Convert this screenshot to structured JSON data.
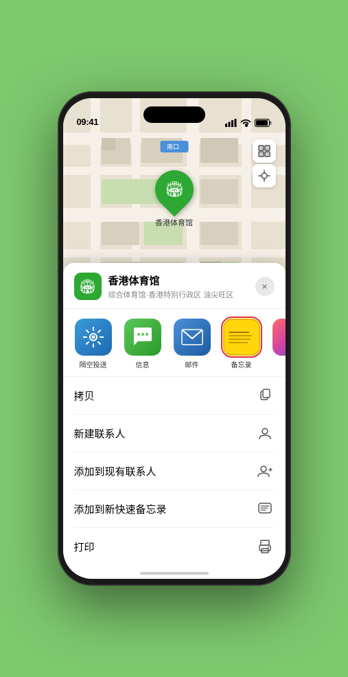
{
  "status_bar": {
    "time": "09:41",
    "location_arrow": "▶",
    "signal": "▐▐▐▐",
    "wifi": "WiFi",
    "battery": "Battery"
  },
  "map": {
    "label": "南口",
    "location_name": "香港体育馆",
    "pin_emoji": "🏟"
  },
  "location_header": {
    "name": "香港体育馆",
    "subtitle": "综合体育馆·香港特别行政区 油尖旺区",
    "close_label": "×"
  },
  "share_apps": [
    {
      "id": "airdrop",
      "label": "隔空投送"
    },
    {
      "id": "messages",
      "label": "信息"
    },
    {
      "id": "mail",
      "label": "邮件"
    },
    {
      "id": "notes",
      "label": "备忘录",
      "selected": true
    },
    {
      "id": "more",
      "label": "提"
    }
  ],
  "actions": [
    {
      "id": "copy",
      "label": "拷贝",
      "icon": "copy"
    },
    {
      "id": "new-contact",
      "label": "新建联系人",
      "icon": "person"
    },
    {
      "id": "add-existing",
      "label": "添加到现有联系人",
      "icon": "person-add"
    },
    {
      "id": "add-notes",
      "label": "添加到新快速备忘录",
      "icon": "memo"
    },
    {
      "id": "print",
      "label": "打印",
      "icon": "print"
    }
  ]
}
